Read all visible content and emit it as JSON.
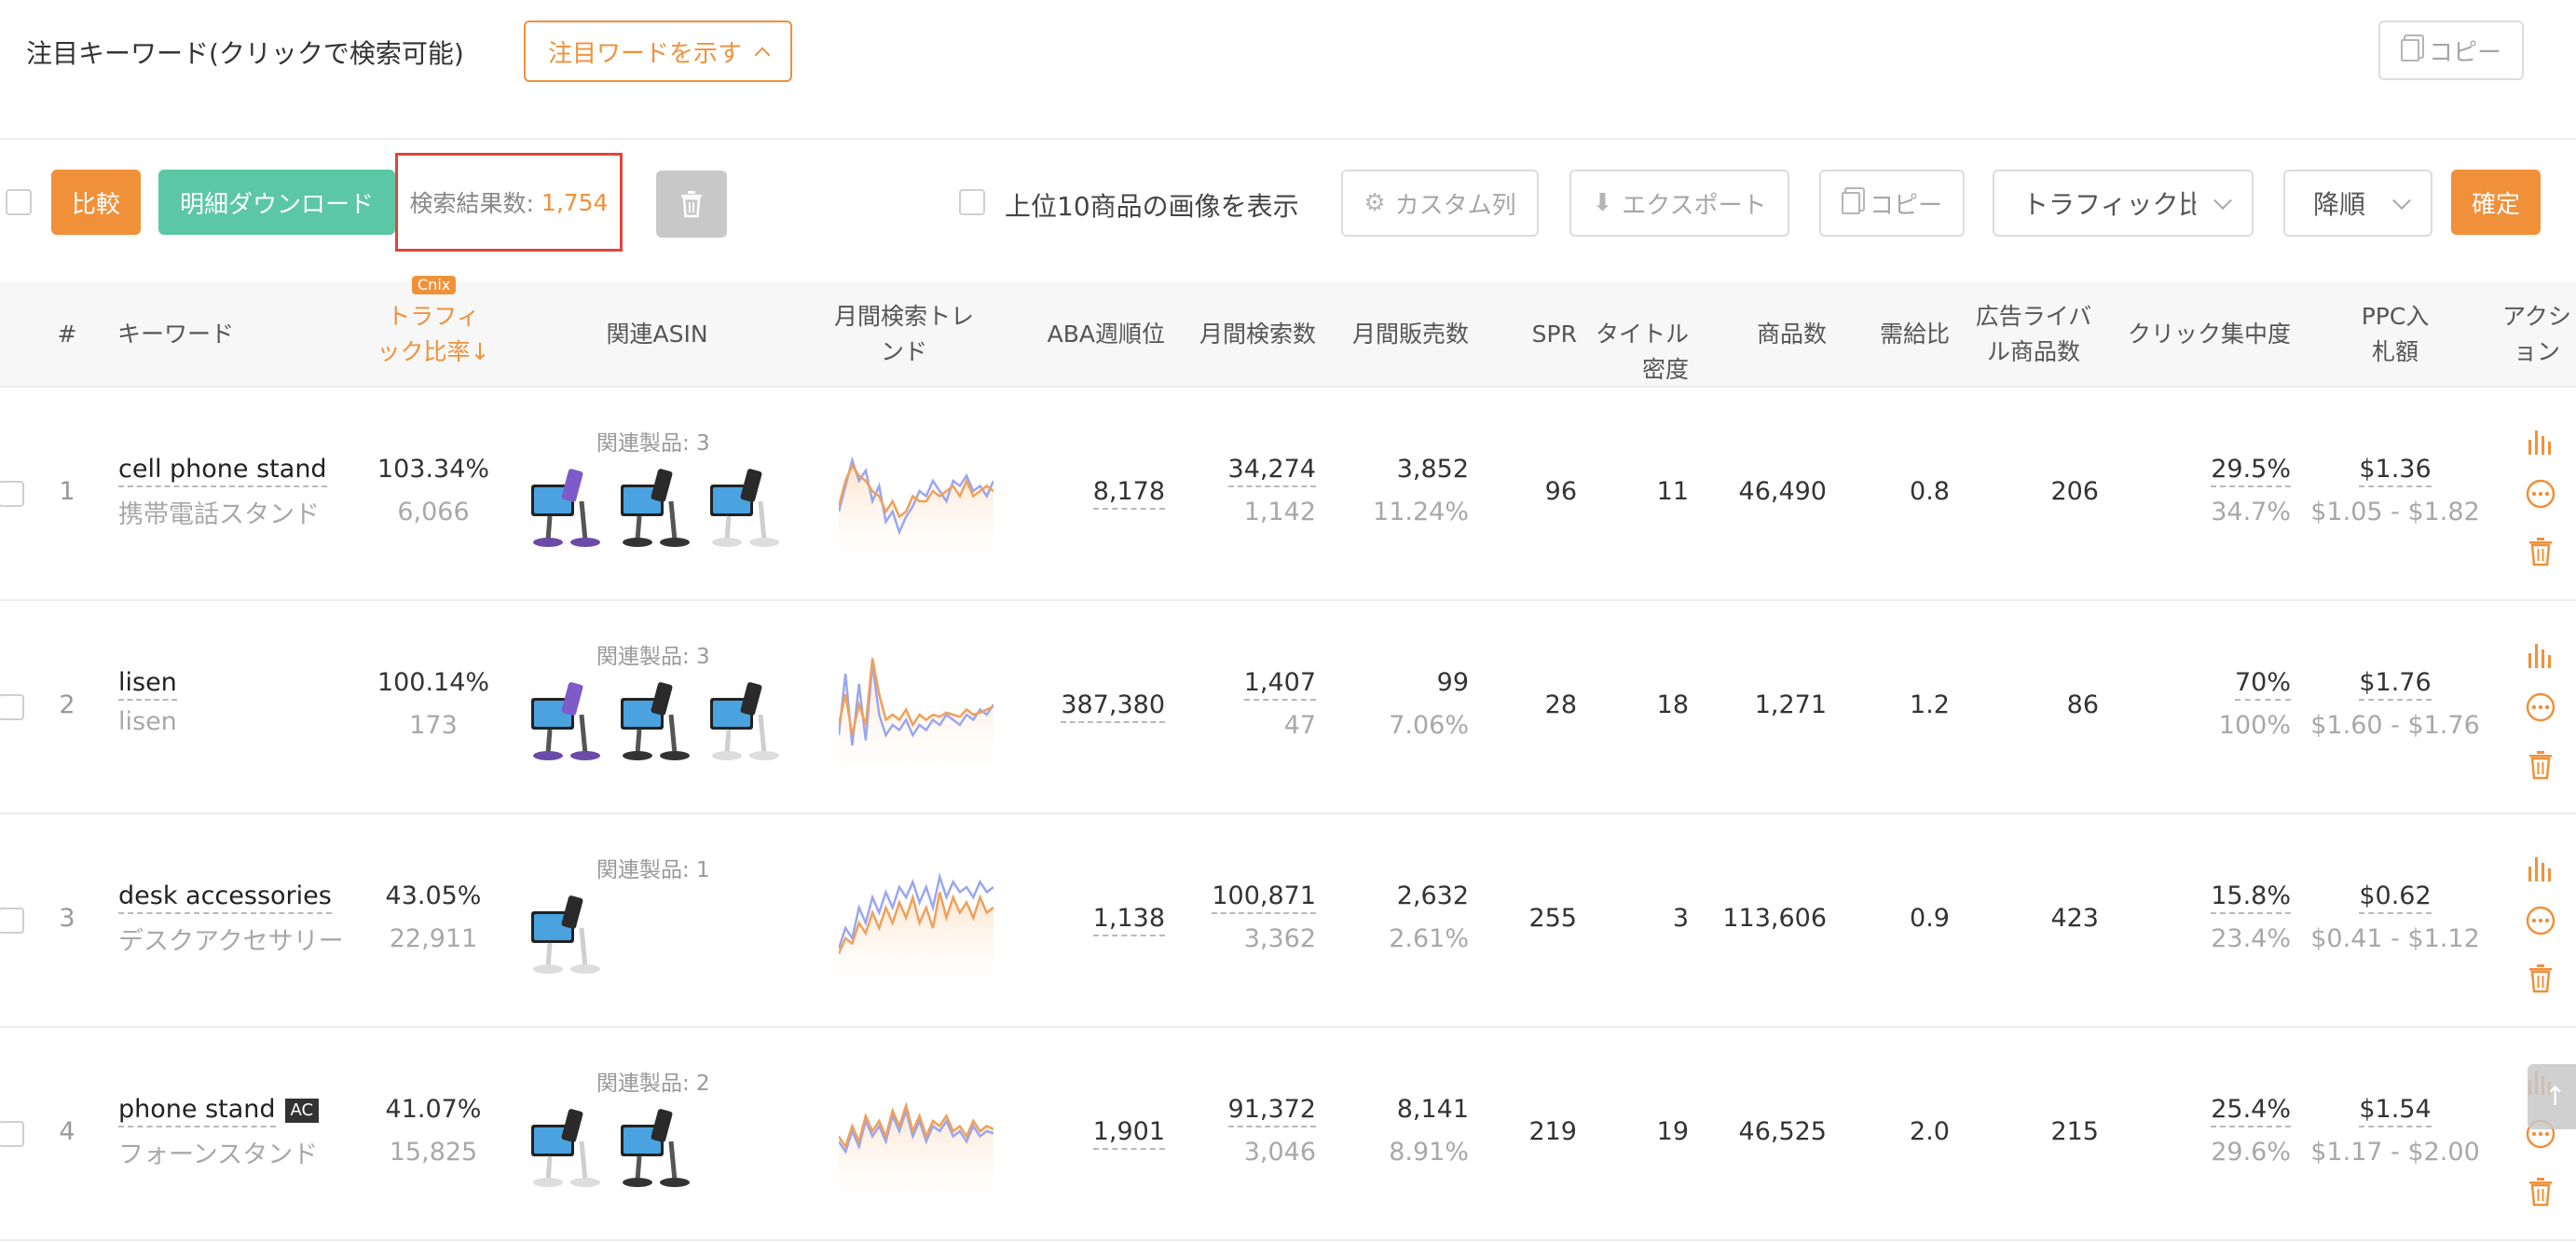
{
  "keywords_bar": {
    "title": "注目キーワード(クリックで検索可能)",
    "toggle_label": "注目ワードを示す",
    "copy_label": "コピー"
  },
  "toolbar": {
    "compare_label": "比較",
    "download_label": "明細ダウンロード",
    "result_label": "検索結果数:",
    "result_count": "1,754",
    "show_images_label": "上位10商品の画像を表示",
    "custom_columns_label": "カスタム列",
    "export_label": "エクスポート",
    "copy_label": "コピー",
    "sort_field_value": "トラフィック比",
    "sort_order_value": "降順",
    "confirm_label": "確定"
  },
  "columns": {
    "index": "#",
    "keyword": "キーワード",
    "traffic_tag": "Cnix",
    "traffic_line1": "トラフィ",
    "traffic_line2": "ック比率↓",
    "asin": "関連ASIN",
    "trend_line1": "月間検索トレ",
    "trend_line2": "ンド",
    "aba": "ABA週順位",
    "monthly_search": "月間検索数",
    "monthly_sales": "月間販売数",
    "spr": "SPR",
    "title_density_line1": "タイトル",
    "title_density_line2": "密度",
    "products": "商品数",
    "supply_ratio": "需給比",
    "ad_rival_line1": "広告ライバ",
    "ad_rival_line2": "ル商品数",
    "click_concentration": "クリック集中度",
    "ppc_line1": "PPC入",
    "ppc_line2": "札額",
    "action_line1": "アクシ",
    "action_line2": "ョン"
  },
  "rows": [
    {
      "index": "1",
      "keyword": "cell phone stand",
      "keyword_jp": "携帯電話スタンド",
      "badge": "",
      "traffic_pct": "103.34%",
      "traffic_num": "6,066",
      "related": "関連製品: 3",
      "thumb_count": 3,
      "aba": "8,178",
      "search": "34,274",
      "search_sub": "1,142",
      "sales": "3,852",
      "sales_sub": "11.24%",
      "spr": "96",
      "title_density": "11",
      "products": "46,490",
      "supply": "0.8",
      "ad_rivals": "206",
      "click": "29.5%",
      "click_sub": "34.7%",
      "ppc": "$1.36",
      "ppc_range": "$1.05 - $1.82",
      "trend_blue": [
        30,
        55,
        80,
        60,
        70,
        40,
        55,
        20,
        30,
        10,
        25,
        35,
        50,
        45,
        60,
        50,
        40,
        60,
        55,
        65,
        50,
        55,
        45,
        60
      ],
      "trend_orange": [
        35,
        60,
        75,
        65,
        60,
        50,
        45,
        30,
        40,
        25,
        30,
        45,
        40,
        40,
        50,
        45,
        50,
        55,
        45,
        60,
        45,
        50,
        55,
        50
      ]
    },
    {
      "index": "2",
      "keyword": "lisen",
      "keyword_jp": "lisen",
      "badge": "",
      "traffic_pct": "100.14%",
      "traffic_num": "173",
      "related": "関連製品: 3",
      "thumb_count": 3,
      "aba": "387,380",
      "search": "1,407",
      "search_sub": "47",
      "sales": "99",
      "sales_sub": "7.06%",
      "spr": "28",
      "title_density": "18",
      "products": "1,271",
      "supply": "1.2",
      "ad_rivals": "86",
      "click": "70%",
      "click_sub": "100%",
      "ppc": "$1.76",
      "ppc_range": "$1.60 - $1.76",
      "trend_blue": [
        20,
        80,
        10,
        70,
        15,
        90,
        40,
        20,
        30,
        25,
        35,
        20,
        30,
        25,
        35,
        30,
        40,
        35,
        30,
        40,
        35,
        45,
        40,
        50
      ],
      "trend_orange": [
        30,
        60,
        20,
        50,
        30,
        95,
        60,
        35,
        40,
        35,
        45,
        30,
        40,
        35,
        40,
        38,
        42,
        40,
        38,
        45,
        40,
        42,
        45,
        48
      ]
    },
    {
      "index": "3",
      "keyword": "desk accessories",
      "keyword_jp": "デスクアクセサリー",
      "badge": "",
      "traffic_pct": "43.05%",
      "traffic_num": "22,911",
      "related": "関連製品: 1",
      "thumb_count": 1,
      "aba": "1,138",
      "search": "100,871",
      "search_sub": "3,362",
      "sales": "2,632",
      "sales_sub": "2.61%",
      "spr": "255",
      "title_density": "3",
      "products": "113,606",
      "supply": "0.9",
      "ad_rivals": "423",
      "click": "15.8%",
      "click_sub": "23.4%",
      "ppc": "$0.62",
      "ppc_range": "$0.41 - $1.12",
      "trend_blue": [
        20,
        40,
        30,
        60,
        45,
        70,
        55,
        75,
        60,
        80,
        70,
        85,
        65,
        80,
        60,
        90,
        70,
        85,
        75,
        80,
        70,
        85,
        75,
        80
      ],
      "trend_orange": [
        15,
        30,
        25,
        45,
        35,
        55,
        40,
        60,
        45,
        65,
        50,
        70,
        45,
        60,
        40,
        75,
        50,
        70,
        55,
        65,
        50,
        70,
        55,
        60
      ]
    },
    {
      "index": "4",
      "keyword": "phone stand",
      "keyword_jp": "フォーンスタンド",
      "badge": "AC",
      "traffic_pct": "41.07%",
      "traffic_num": "15,825",
      "related": "関連製品: 2",
      "thumb_count": 2,
      "aba": "1,901",
      "search": "91,372",
      "search_sub": "3,046",
      "sales": "8,141",
      "sales_sub": "8.91%",
      "spr": "219",
      "title_density": "19",
      "products": "46,525",
      "supply": "2.0",
      "ad_rivals": "215",
      "click": "25.4%",
      "click_sub": "29.6%",
      "ppc": "$1.54",
      "ppc_range": "$1.17 - $2.00",
      "trend_blue": [
        40,
        30,
        50,
        35,
        60,
        45,
        55,
        40,
        65,
        50,
        70,
        45,
        60,
        40,
        55,
        50,
        60,
        45,
        50,
        40,
        55,
        45,
        50,
        48
      ],
      "trend_orange": [
        45,
        35,
        55,
        40,
        65,
        50,
        60,
        45,
        70,
        55,
        75,
        50,
        65,
        45,
        60,
        55,
        65,
        50,
        55,
        45,
        60,
        50,
        55,
        52
      ]
    }
  ],
  "colors": {
    "accent": "#f0913a",
    "green": "#5cc7a5",
    "highlight_border": "#e0453a",
    "trend_blue": "#9aa6f2",
    "trend_orange": "#f0a05a"
  }
}
